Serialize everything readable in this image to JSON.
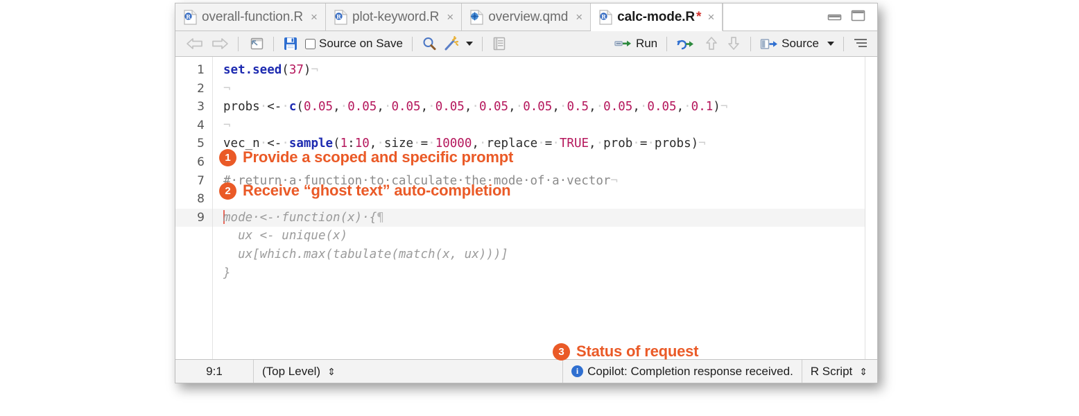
{
  "window": {
    "pane_controls": [
      "minimize-pane",
      "maximize-pane"
    ]
  },
  "tabs": [
    {
      "label": "overall-function.R",
      "icon": "r-file-icon",
      "dirty": "",
      "active": false,
      "close": "×"
    },
    {
      "label": "plot-keyword.R",
      "icon": "r-file-icon",
      "dirty": "",
      "active": false,
      "close": "×"
    },
    {
      "label": "overview.qmd",
      "icon": "quarto-file-icon",
      "dirty": "",
      "active": false,
      "close": "×"
    },
    {
      "label": "calc-mode.R",
      "icon": "r-file-icon",
      "dirty": "*",
      "active": true,
      "close": "×"
    }
  ],
  "toolbar": {
    "back_icon": "back-arrow-icon",
    "forward_icon": "forward-arrow-icon",
    "popout_icon": "show-in-new-window-icon",
    "save_icon": "save-icon",
    "source_on_save_label": "Source on Save",
    "find_icon": "magnifier-icon",
    "wand_icon": "magic-wand-icon",
    "compile_report_icon": "compile-report-icon",
    "run_label": "Run",
    "run_icon": "run-icon",
    "rerun_icon": "rerun-icon",
    "prev_chunk_icon": "up-arrow-icon",
    "next_chunk_icon": "down-arrow-icon",
    "source_label": "Source",
    "source_icon": "source-icon",
    "outline_icon": "document-outline-icon"
  },
  "editor": {
    "lines": [
      {
        "num": "1",
        "tokens": [
          {
            "t": "set.seed",
            "c": "kw"
          },
          {
            "t": "(",
            "c": "pln"
          },
          {
            "t": "37",
            "c": "num"
          },
          {
            "t": ")",
            "c": "pln"
          },
          {
            "t": "¬",
            "c": "eol"
          }
        ]
      },
      {
        "num": "2",
        "tokens": [
          {
            "t": "¬",
            "c": "eol"
          }
        ]
      },
      {
        "num": "3",
        "tokens": [
          {
            "t": "probs",
            "c": "pln"
          },
          {
            "t": "·",
            "c": "dot"
          },
          {
            "t": "<-",
            "c": "pln"
          },
          {
            "t": "·",
            "c": "dot"
          },
          {
            "t": "c",
            "c": "kw"
          },
          {
            "t": "(",
            "c": "pln"
          },
          {
            "t": "0.05",
            "c": "num"
          },
          {
            "t": ",",
            "c": "pln"
          },
          {
            "t": "·",
            "c": "dot"
          },
          {
            "t": "0.05",
            "c": "num"
          },
          {
            "t": ",",
            "c": "pln"
          },
          {
            "t": "·",
            "c": "dot"
          },
          {
            "t": "0.05",
            "c": "num"
          },
          {
            "t": ",",
            "c": "pln"
          },
          {
            "t": "·",
            "c": "dot"
          },
          {
            "t": "0.05",
            "c": "num"
          },
          {
            "t": ",",
            "c": "pln"
          },
          {
            "t": "·",
            "c": "dot"
          },
          {
            "t": "0.05",
            "c": "num"
          },
          {
            "t": ",",
            "c": "pln"
          },
          {
            "t": "·",
            "c": "dot"
          },
          {
            "t": "0.05",
            "c": "num"
          },
          {
            "t": ",",
            "c": "pln"
          },
          {
            "t": "·",
            "c": "dot"
          },
          {
            "t": "0.5",
            "c": "num"
          },
          {
            "t": ",",
            "c": "pln"
          },
          {
            "t": "·",
            "c": "dot"
          },
          {
            "t": "0.05",
            "c": "num"
          },
          {
            "t": ",",
            "c": "pln"
          },
          {
            "t": "·",
            "c": "dot"
          },
          {
            "t": "0.05",
            "c": "num"
          },
          {
            "t": ",",
            "c": "pln"
          },
          {
            "t": "·",
            "c": "dot"
          },
          {
            "t": "0.1",
            "c": "num"
          },
          {
            "t": ")",
            "c": "pln"
          },
          {
            "t": "¬",
            "c": "eol"
          }
        ]
      },
      {
        "num": "4",
        "tokens": [
          {
            "t": "¬",
            "c": "eol"
          }
        ]
      },
      {
        "num": "5",
        "tokens": [
          {
            "t": "vec_n",
            "c": "pln"
          },
          {
            "t": "·",
            "c": "dot"
          },
          {
            "t": "<-",
            "c": "pln"
          },
          {
            "t": "·",
            "c": "dot"
          },
          {
            "t": "sample",
            "c": "kw"
          },
          {
            "t": "(",
            "c": "pln"
          },
          {
            "t": "1",
            "c": "num"
          },
          {
            "t": ":",
            "c": "pln"
          },
          {
            "t": "10",
            "c": "num"
          },
          {
            "t": ",",
            "c": "pln"
          },
          {
            "t": "·",
            "c": "dot"
          },
          {
            "t": "size",
            "c": "pln"
          },
          {
            "t": "·",
            "c": "dot"
          },
          {
            "t": "=",
            "c": "pln"
          },
          {
            "t": "·",
            "c": "dot"
          },
          {
            "t": "10000",
            "c": "num"
          },
          {
            "t": ",",
            "c": "pln"
          },
          {
            "t": "·",
            "c": "dot"
          },
          {
            "t": "replace",
            "c": "pln"
          },
          {
            "t": "·",
            "c": "dot"
          },
          {
            "t": "=",
            "c": "pln"
          },
          {
            "t": "·",
            "c": "dot"
          },
          {
            "t": "TRUE",
            "c": "cst"
          },
          {
            "t": ",",
            "c": "pln"
          },
          {
            "t": "·",
            "c": "dot"
          },
          {
            "t": "prob",
            "c": "pln"
          },
          {
            "t": "·",
            "c": "dot"
          },
          {
            "t": "=",
            "c": "pln"
          },
          {
            "t": "·",
            "c": "dot"
          },
          {
            "t": "probs",
            "c": "pln"
          },
          {
            "t": ")",
            "c": "pln"
          },
          {
            "t": "¬",
            "c": "eol"
          }
        ]
      },
      {
        "num": "6",
        "tokens": []
      },
      {
        "num": "7",
        "tokens": [
          {
            "t": "#·return·a·function·to·calculate·the·mode·of·a·vector",
            "c": "cmt"
          },
          {
            "t": "¬",
            "c": "eol"
          }
        ]
      },
      {
        "num": "8",
        "tokens": []
      },
      {
        "num": "9",
        "current": true,
        "cursor": true,
        "tokens": [
          {
            "t": "mode·<-·function(x)·{",
            "c": "ghost"
          },
          {
            "t": "¶",
            "c": "pilcrow"
          }
        ]
      },
      {
        "num": "",
        "tokens": [
          {
            "t": "  ux <- unique(x)",
            "c": "ghost"
          }
        ]
      },
      {
        "num": "",
        "tokens": [
          {
            "t": "  ux[which.max(tabulate(match(x, ux)))]",
            "c": "ghost"
          }
        ]
      },
      {
        "num": "",
        "tokens": [
          {
            "t": "}",
            "c": "ghost"
          }
        ]
      }
    ]
  },
  "statusbar": {
    "cursor_position": "9:1",
    "scope": "(Top Level)",
    "scope_chevron": "⇕",
    "copilot_status": "Copilot: Completion response received.",
    "info_icon": "info-icon",
    "file_type": "R Script",
    "file_type_chevron": "⇕"
  },
  "annotations": [
    {
      "number": "1",
      "text": "Provide a scoped and specific prompt"
    },
    {
      "number": "2",
      "text": "Receive “ghost text” auto-completion"
    },
    {
      "number": "3",
      "text": "Status of request"
    }
  ],
  "colors": {
    "annotation_orange": "#ea5a27",
    "keyword_blue": "#1d2ab0",
    "number_crimson": "#b5175c",
    "comment_gray": "#8b8b8b",
    "ghost_gray": "#9b9b9b",
    "dirty_red": "#d0312d",
    "info_blue": "#2f6fd0"
  }
}
